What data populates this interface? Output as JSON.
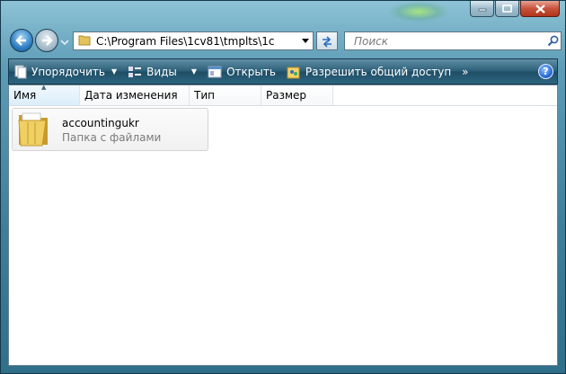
{
  "address": {
    "path": "C:\\Program Files\\1cv81\\tmplts\\1c"
  },
  "search": {
    "placeholder": "Поиск"
  },
  "toolbar": {
    "organize_label": "Упорядочить",
    "views_label": "Виды",
    "open_label": "Открыть",
    "share_label": "Разрешить общий доступ",
    "more_label": "»",
    "help_label": "?"
  },
  "columns": {
    "name": "Имя",
    "date_modified": "Дата изменения",
    "type": "Тип",
    "size": "Размер"
  },
  "items": [
    {
      "name": "accountingukr",
      "type": "Папка с файлами"
    }
  ],
  "icons": {
    "back": "back-arrow-icon",
    "forward": "forward-arrow-icon",
    "folder": "folder-icon",
    "refresh": "refresh-icon",
    "search": "magnifier-icon"
  }
}
